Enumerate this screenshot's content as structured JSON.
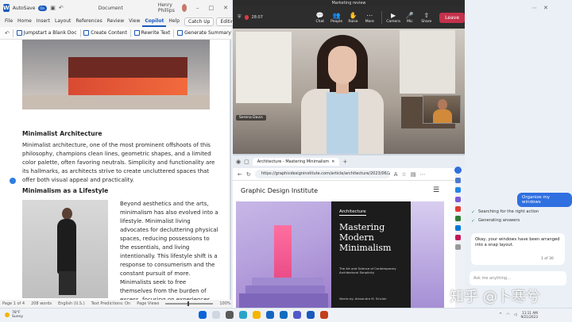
{
  "word": {
    "autosave_label": "AutoSave",
    "autosave_state": "On",
    "document_name": "Document",
    "user_name": "Henry Phillips",
    "tabs": [
      {
        "label": "File"
      },
      {
        "label": "Home"
      },
      {
        "label": "Insert"
      },
      {
        "label": "Layout"
      },
      {
        "label": "References"
      },
      {
        "label": "Review"
      },
      {
        "label": "View"
      },
      {
        "label": "Copilot"
      },
      {
        "label": "Help"
      }
    ],
    "catch_up": "Catch Up",
    "editing": "Editing",
    "ribbon": {
      "jumpstart": "Jumpstart a Blank Doc",
      "create_content": "Create Content",
      "rewrite_text": "Rewrite Text",
      "generate_summary": "Generate Summary"
    },
    "heading1": "Minimalist Architecture",
    "para1": "Minimalist architecture, one of the most prominent offshoots of this philosophy, champions clean lines, geometric shapes, and a limited color palette, often favoring neutrals. Simplicity and functionality are its hallmarks, as architects strive to create uncluttered spaces that offer both visual appeal and practicality.",
    "heading2": "Minimalism as a Lifestyle",
    "para2": "Beyond aesthetics and the arts, minimalism has also evolved into a lifestyle. Minimalist living advocates for decluttering physical spaces, reducing possessions to the essentials, and living intentionally. This lifestyle shift is a response to consumerism and the constant pursuit of more. Minimalists seek to free themselves from the burden of excess, focusing on experiences, relationships, and personal growth instead.",
    "status": {
      "page": "Page 1 of 4",
      "words": "208 words",
      "language": "English (U.S.)",
      "predictions": "Text Predictions: On",
      "view": "Page Views",
      "zoom": "100%"
    }
  },
  "teams": {
    "window_title": "Marketing review",
    "timer": "28:07",
    "controls": [
      {
        "label": "Chat",
        "icon": "chat-icon"
      },
      {
        "label": "People",
        "icon": "people-icon"
      },
      {
        "label": "Raise",
        "icon": "raise-hand-icon"
      },
      {
        "label": "More",
        "icon": "more-icon"
      },
      {
        "label": "Camera",
        "icon": "camera-icon"
      },
      {
        "label": "Mic",
        "icon": "mic-icon"
      },
      {
        "label": "Share",
        "icon": "share-icon"
      }
    ],
    "leave_label": "Leave",
    "speaker_name": "Serena Davis"
  },
  "edge": {
    "tab_title": "Architecture - Mastering Minimalism",
    "url": "https://graphicdesigninstitute.com/article/architecture/2023/06/2",
    "site_title": "Graphic Design Institute",
    "hero_category": "Architecture",
    "hero_heading": "Mastering Modern Minimalism",
    "hero_sub": "The Art and Science of Contemporary Architectural Simplicity",
    "hero_byline": "Words by: Alexandra M. Sinclair"
  },
  "copilot": {
    "user_message": "Organize my windows",
    "steps": [
      {
        "label": "Searching for the right action"
      },
      {
        "label": "Generating answers"
      }
    ],
    "answer": "Okay, your windows have been arranged into a snap layout.",
    "count": "1 of 30",
    "input_placeholder": "Ask me anything..."
  },
  "taskbar": {
    "temp": "78°F",
    "weather": "Sunny",
    "time": "11:11 AM",
    "date": "9/21/2023"
  },
  "watermark": "知乎 @卜寒兮",
  "colors": {
    "word_blue": "#185abd",
    "teams_leave": "#c4314b",
    "copilot_blue": "#2f6fe0"
  }
}
